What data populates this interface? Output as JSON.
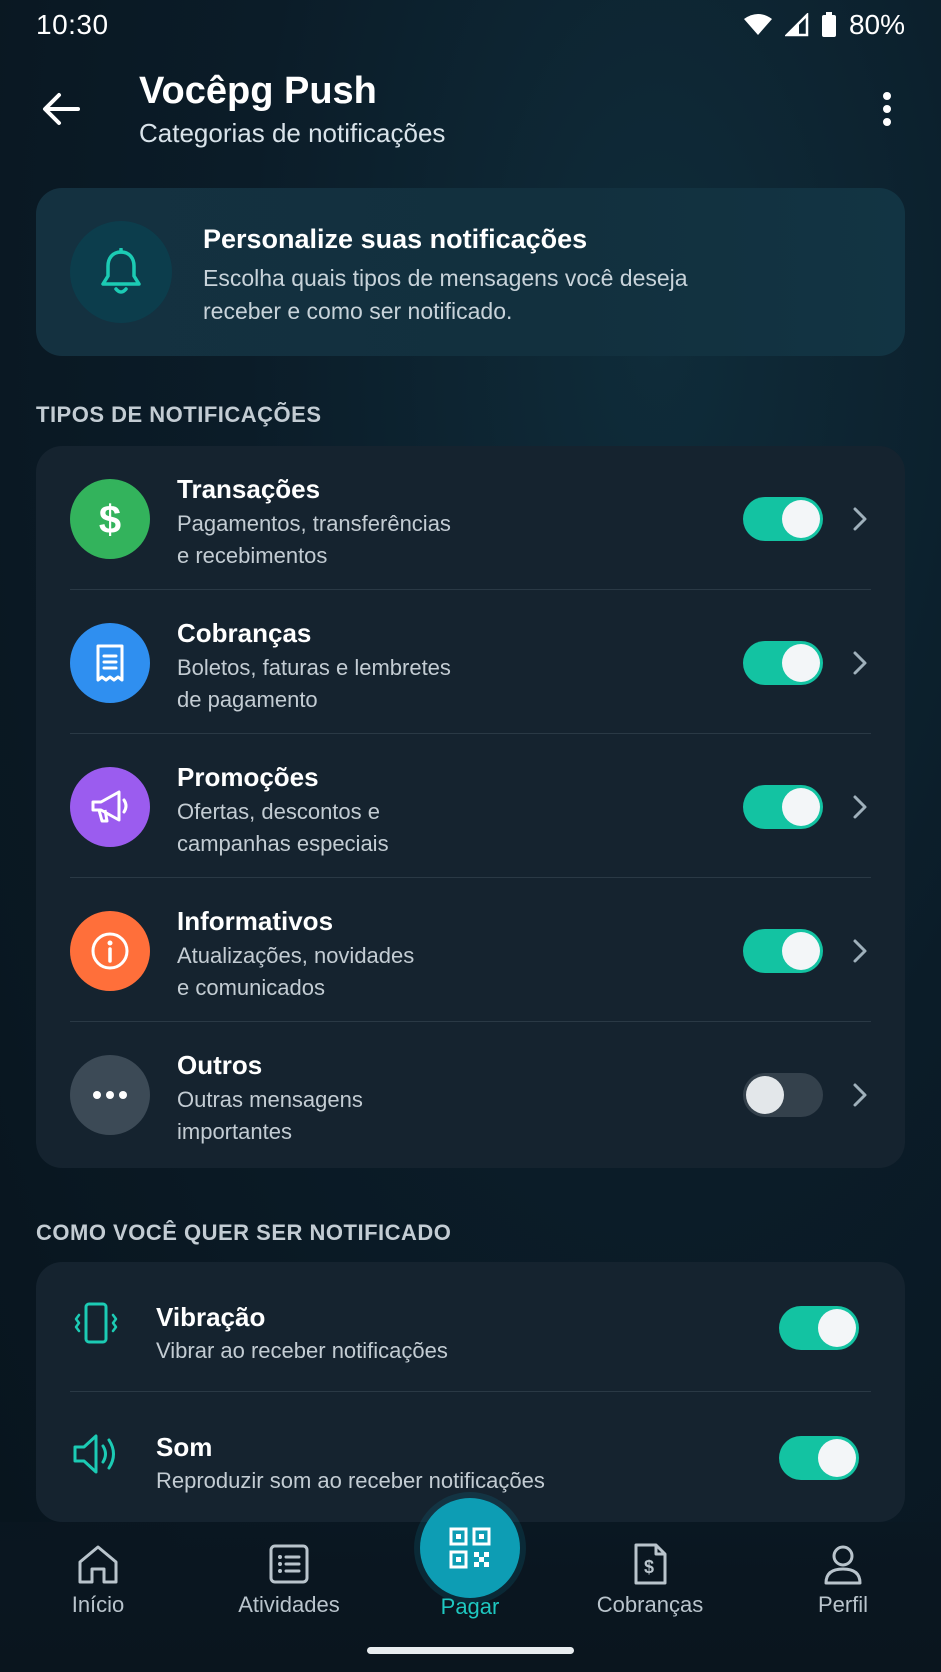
{
  "status_bar": {
    "time": "10:30",
    "battery": "80%"
  },
  "app_bar": {
    "title": "Vocêpg Push",
    "subtitle": "Categorias de notificações"
  },
  "intro": {
    "title": "Personalize suas notificações",
    "description": "Escolha quais tipos de mensagens você deseja receber e como ser notificado.",
    "icon": "bell-icon"
  },
  "types_section": {
    "label": "TIPOS DE NOTIFICAÇÕES",
    "items": [
      {
        "title": "Transações",
        "desc_line1": "Pagamentos, transferências",
        "desc_line2": "e recebimentos",
        "icon": "dollar-icon",
        "color": "#33b35c",
        "enabled": true
      },
      {
        "title": "Cobranças",
        "desc_line1": "Boletos, faturas e lembretes",
        "desc_line2": "de pagamento",
        "icon": "receipt-icon",
        "color": "#2f8ff0",
        "enabled": true
      },
      {
        "title": "Promoções",
        "desc_line1": "Ofertas, descontos e",
        "desc_line2": "campanhas especiais",
        "icon": "megaphone-icon",
        "color": "#9b5cef",
        "enabled": true
      },
      {
        "title": "Informativos",
        "desc_line1": "Atualizações, novidades",
        "desc_line2": "e comunicados",
        "icon": "info-icon",
        "color": "#ff6f3a",
        "enabled": true
      },
      {
        "title": "Outros",
        "desc_line1": "Outras mensagens",
        "desc_line2": "importantes",
        "icon": "more-dots-icon",
        "color": "#3c4a56",
        "enabled": false
      }
    ]
  },
  "notify_section": {
    "label": "COMO VOCÊ QUER SER NOTIFICADO",
    "items": [
      {
        "title": "Vibração",
        "desc": "Vibrar ao receber notificações",
        "icon": "vibration-icon",
        "enabled": true
      },
      {
        "title": "Som",
        "desc": "Reproduzir som ao receber notificações",
        "icon": "speaker-icon",
        "enabled": true
      }
    ]
  },
  "bottom_nav": {
    "items": [
      {
        "label": "Início",
        "icon": "home-icon"
      },
      {
        "label": "Atividades",
        "icon": "list-icon"
      },
      {
        "label": "Pagar",
        "icon": "qr-code-icon"
      },
      {
        "label": "Cobranças",
        "icon": "invoice-icon"
      },
      {
        "label": "Perfil",
        "icon": "user-icon"
      }
    ]
  },
  "colors": {
    "accent": "#13c3a2",
    "fab": "#0d9db4",
    "pay_label": "#1ec7c0"
  }
}
